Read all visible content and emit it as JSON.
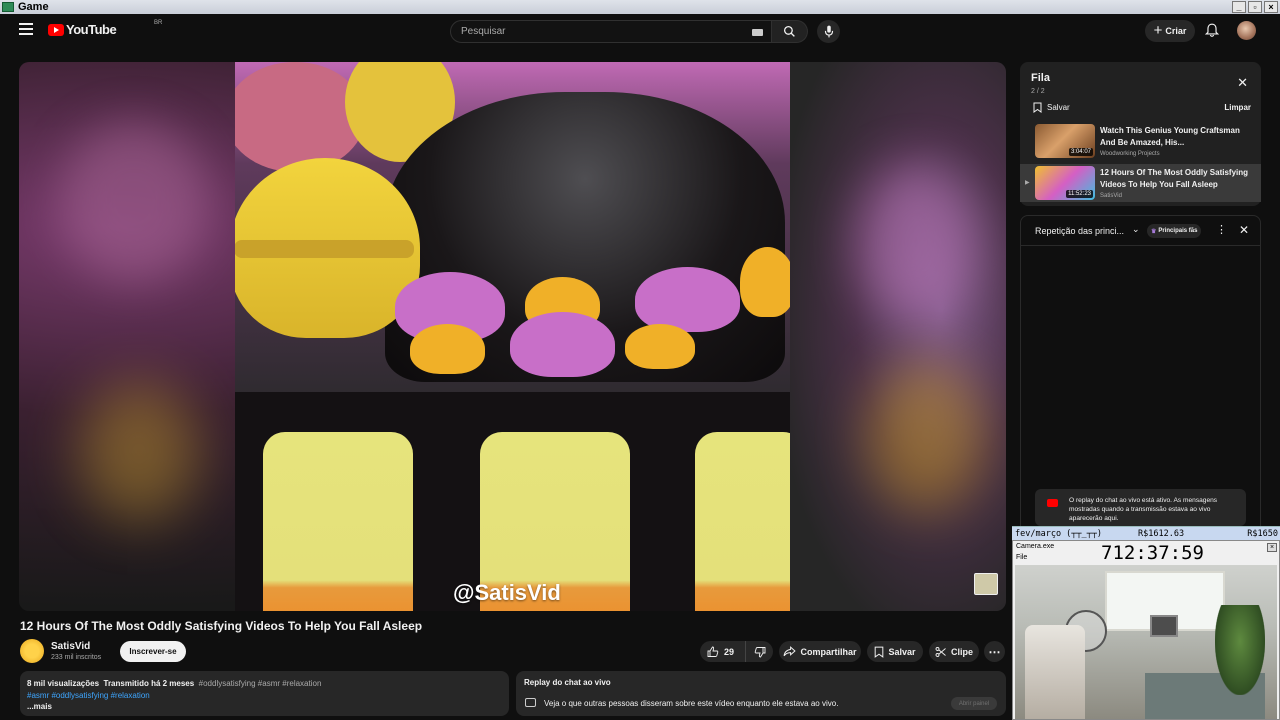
{
  "window": {
    "title": "Game",
    "buttons": [
      "_",
      "▫",
      "×"
    ]
  },
  "masthead": {
    "logo_text": "YouTube",
    "country_code": "BR",
    "search_placeholder": "Pesquisar",
    "create_label": "Criar"
  },
  "video": {
    "watermark": "@SatisVid",
    "title": "12 Hours Of The Most Oddly Satisfying Videos To Help You Fall Asleep"
  },
  "channel": {
    "name": "SatisVid",
    "subscribers": "233 mil inscritos",
    "subscribe_label": "Inscrever-se"
  },
  "actions": {
    "likes": "29",
    "share_label": "Compartilhar",
    "save_label": "Salvar",
    "clip_label": "Clipe"
  },
  "description": {
    "views": "8 mil visualizações",
    "streamed": "Transmitido há 2 meses",
    "tags_line1": "#oddlysatisfying #asmr #relaxation",
    "tags_line2": "#asmr #oddlysatisfying #relaxation",
    "more": "...mais"
  },
  "chat_replay_box": {
    "title": "Replay do chat ao vivo",
    "text": "Veja o que outras pessoas disseram sobre este vídeo enquanto ele estava ao vivo.",
    "open_panel": "Abrir painel"
  },
  "queue": {
    "title": "Fila",
    "count": "2 / 2",
    "save_label": "Salvar",
    "clear_label": "Limpar",
    "items": [
      {
        "title": "Watch This Genius Young Craftsman And Be Amazed, His...",
        "channel": "Woodworking Projects",
        "duration": "3:04:07"
      },
      {
        "title": "12 Hours Of The Most Oddly Satisfying Videos To Help You Fall Asleep",
        "channel": "SatisVid",
        "duration": "11:52:23"
      }
    ]
  },
  "chat_panel": {
    "selector": "Repetição das princi...",
    "badge": "Principais fãs",
    "note": "O replay do chat ao vivo está ativo. As mensagens mostradas quando a transmissão estava ao vivo aparecerão aqui."
  },
  "overlay_sticky": {
    "left": "fev/março (┬┬_┬┬)",
    "mid": "R$1612.63",
    "right": "R$1650"
  },
  "camera": {
    "title": "Camera.exe",
    "menu": "File",
    "timer": "712:37:59"
  },
  "colors": {
    "accent_red": "#ff0000",
    "link_blue": "#3ea6ff",
    "bg": "#0f0f0f"
  }
}
